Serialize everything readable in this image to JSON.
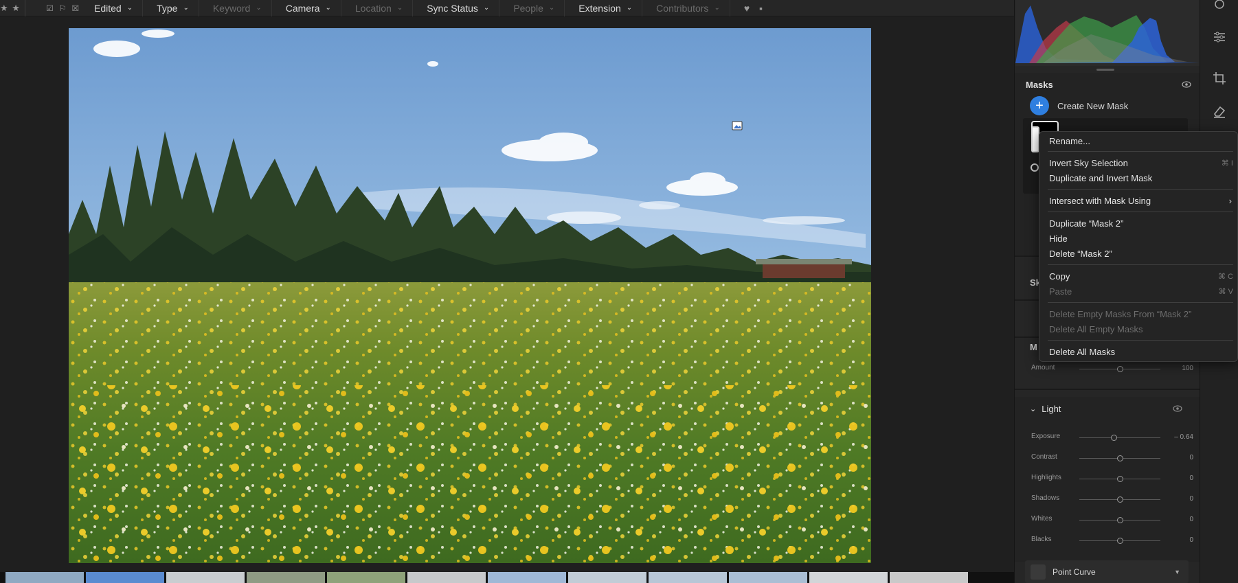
{
  "filterbar": {
    "stars": "★ ★",
    "filters": [
      {
        "label": "Edited",
        "enabled": true
      },
      {
        "label": "Type",
        "enabled": true
      },
      {
        "label": "Keyword",
        "enabled": false
      },
      {
        "label": "Camera",
        "enabled": true
      },
      {
        "label": "Location",
        "enabled": false
      },
      {
        "label": "Sync Status",
        "enabled": true
      },
      {
        "label": "People",
        "enabled": false
      },
      {
        "label": "Extension",
        "enabled": true
      },
      {
        "label": "Contributors",
        "enabled": false
      }
    ]
  },
  "masks": {
    "title": "Masks",
    "create_label": "Create New Mask",
    "create_symbol": "+"
  },
  "panel_stubs": {
    "sky_prefix": "Sk",
    "mask_prefix": "M"
  },
  "amount": {
    "label": "Amount",
    "value": "100",
    "position": 0.5
  },
  "light": {
    "title": "Light",
    "sliders": [
      {
        "label": "Exposure",
        "value": "– 0.64",
        "position": 0.42
      },
      {
        "label": "Contrast",
        "value": "0",
        "position": 0.5
      },
      {
        "label": "Highlights",
        "value": "0",
        "position": 0.5
      },
      {
        "label": "Shadows",
        "value": "0",
        "position": 0.5
      },
      {
        "label": "Whites",
        "value": "0",
        "position": 0.5
      },
      {
        "label": "Blacks",
        "value": "0",
        "position": 0.5
      }
    ]
  },
  "point_curve": {
    "label": "Point Curve"
  },
  "context_menu": {
    "items": {
      "rename": "Rename...",
      "invert_sky": "Invert Sky Selection",
      "invert_sky_shortcut": "⌘ I",
      "duplicate_invert": "Duplicate and Invert Mask",
      "intersect": "Intersect with Mask Using",
      "duplicate": "Duplicate “Mask 2”",
      "hide": "Hide",
      "delete": "Delete “Mask 2”",
      "copy": "Copy",
      "copy_shortcut": "⌘ C",
      "paste": "Paste",
      "paste_shortcut": "⌘ V",
      "delete_empty_from": "Delete Empty Masks From “Mask 2”",
      "delete_all_empty": "Delete All Empty Masks",
      "delete_all": "Delete All Masks"
    }
  },
  "colors": {
    "accent": "#2f7fe0",
    "panel_bg": "#262626",
    "menu_bg": "#242424"
  },
  "icons": [
    "star-icon",
    "flag-icon",
    "chevron-down-icon",
    "heart-icon",
    "comment-icon",
    "eye-icon",
    "plus-icon",
    "chevron-right-icon",
    "settings-sliders-icon",
    "crop-icon",
    "eraser-icon",
    "point-curve-icon"
  ]
}
